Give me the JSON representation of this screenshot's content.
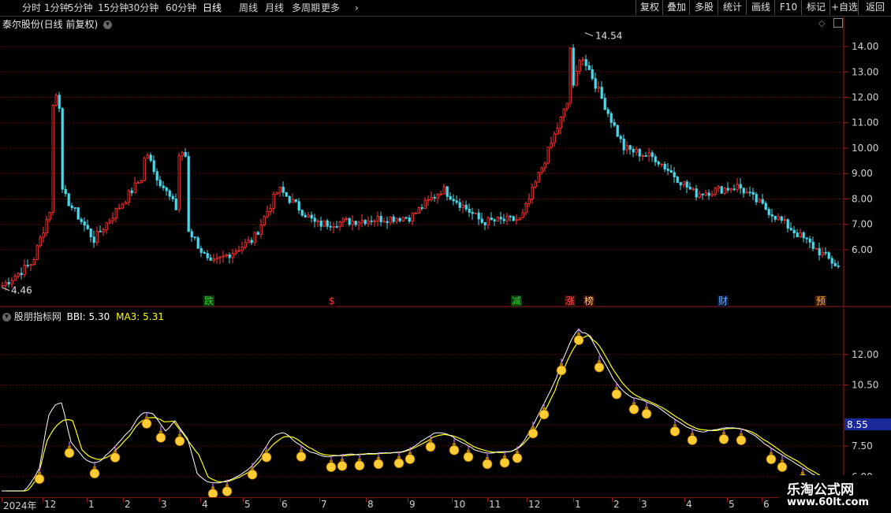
{
  "toolbar": {
    "left_items": [
      "分时",
      "1分钟",
      "5分钟",
      "15分钟",
      "30分钟",
      "60分钟",
      "日线",
      "周线",
      "月线",
      "多周期",
      "更多"
    ],
    "active": "日线",
    "right_items": [
      "复权",
      "叠加",
      "多股",
      "统计",
      "画线",
      "F10",
      "标记",
      "+自选",
      "返回"
    ]
  },
  "main": {
    "title": "泰尔股份(日线 前复权)",
    "price_labels": [
      "14.00",
      "13.00",
      "12.00",
      "11.00",
      "10.00",
      "9.00",
      "8.00",
      "7.00",
      "6.00"
    ],
    "high_label": "14.54",
    "low_label": "4.46",
    "badges": [
      {
        "text": "跌",
        "color": "#33cc33",
        "bg": "#0a3a0a"
      },
      {
        "text": "$",
        "color": "#ff3333",
        "bg": "#000000"
      },
      {
        "text": "减",
        "color": "#33cc33",
        "bg": "#0a3a0a"
      },
      {
        "text": "涨",
        "color": "#ff5555",
        "bg": "#3a0a0a"
      },
      {
        "text": "榜",
        "color": "#ffcc66",
        "bg": "#3a0a0a"
      },
      {
        "text": "财",
        "color": "#66aaff",
        "bg": "#0a1a3a"
      },
      {
        "text": "预",
        "color": "#ffaa33",
        "bg": "#3a1a0a"
      }
    ]
  },
  "indicator": {
    "name": "股朋指标网",
    "bbi_label": "BBI: 5.30",
    "ma3_label": "MA3: 5.31",
    "axis_labels": [
      "12.00",
      "10.50",
      "7.50",
      "6.00"
    ],
    "current_value": "8.55",
    "colors": {
      "bbi": "#ffffff",
      "ma3": "#ffff00",
      "icon": "#ffcc33"
    }
  },
  "xaxis": {
    "labels": [
      "2024年",
      "12",
      "1",
      "2",
      "3",
      "4",
      "5",
      "6",
      "7",
      "8",
      "9",
      "10",
      "11",
      "12",
      "1",
      "2",
      "3",
      "4",
      "5",
      "6"
    ]
  },
  "watermark": {
    "line1": "乐淘公式网",
    "line2": "www.60lt.com"
  },
  "chart_data": {
    "type": "candlestick",
    "title": "泰尔股份(日线 前复权)",
    "ylim": [
      4.2,
      14.9
    ],
    "high": 14.54,
    "low": 4.46,
    "key_prices": [
      {
        "date_label": "2024年",
        "value": 4.6
      },
      {
        "date_label": "12",
        "value": 5.5
      },
      {
        "date_label": "1",
        "value": 8.5
      },
      {
        "date_label": "2",
        "value": 6.4
      },
      {
        "date_label": "3",
        "value": 9.3
      },
      {
        "date_label": "4",
        "value": 5.4
      },
      {
        "date_label": "5",
        "value": 6.4
      },
      {
        "date_label": "6",
        "value": 8.4
      },
      {
        "date_label": "7",
        "value": 7.0
      },
      {
        "date_label": "8",
        "value": 7.2
      },
      {
        "date_label": "9",
        "value": 7.3
      },
      {
        "date_label": "10",
        "value": 8.4
      },
      {
        "date_label": "11",
        "value": 7.1
      },
      {
        "date_label": "12",
        "value": 7.2
      },
      {
        "date_label": "1",
        "value": 13.5
      },
      {
        "date_label": "2",
        "value": 10.0
      },
      {
        "date_label": "3",
        "value": 9.6
      },
      {
        "date_label": "4",
        "value": 8.2
      },
      {
        "date_label": "5",
        "value": 8.5
      },
      {
        "date_label": "6",
        "value": 5.3
      }
    ],
    "indicator": {
      "series": [
        {
          "name": "BBI",
          "last": 5.3
        },
        {
          "name": "MA3",
          "last": 5.31
        }
      ],
      "ylim": [
        5.3,
        13.5
      ]
    }
  }
}
